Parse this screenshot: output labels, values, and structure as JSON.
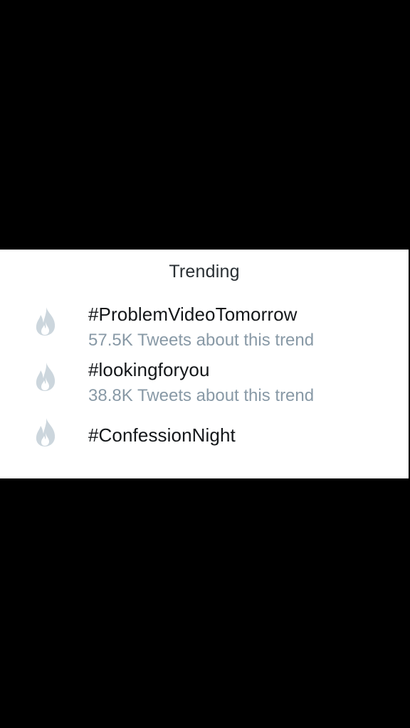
{
  "colors": {
    "background": "#000000",
    "card": "#ffffff",
    "title": "#292f33",
    "trend_text": "#14171a",
    "meta_text": "#8899a6",
    "flame_icon": "#ccd6dd"
  },
  "panel": {
    "title": "Trending"
  },
  "trends": [
    {
      "icon": "flame-icon",
      "name": "#ProblemVideoTomorrow",
      "meta": "57.5K Tweets about this trend"
    },
    {
      "icon": "flame-icon",
      "name": "#lookingforyou",
      "meta": "38.8K Tweets about this trend"
    },
    {
      "icon": "flame-icon",
      "name": "#ConfessionNight"
    }
  ]
}
